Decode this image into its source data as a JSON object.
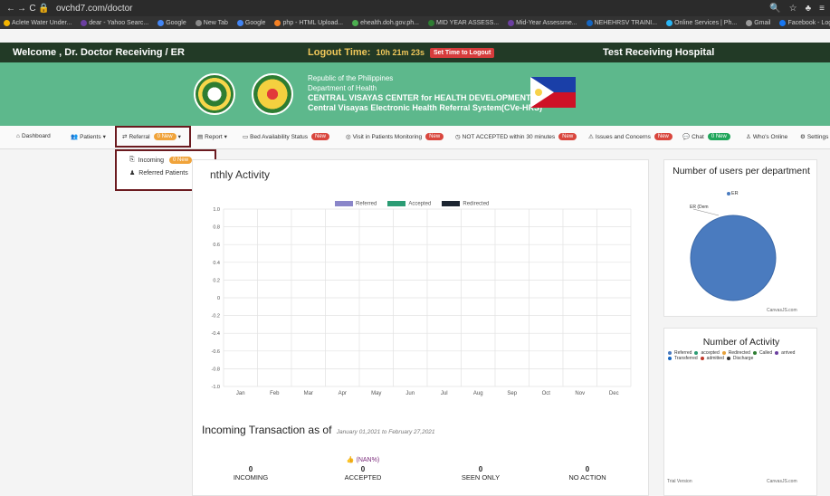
{
  "browser": {
    "url": "ovchd7.com/doctor",
    "bookmarks": [
      "Aclete Water Under...",
      "dear - Yahoo Searc...",
      "Google",
      "New Tab",
      "Google",
      "php - HTML Upload...",
      "ehealth.doh.gov.ph...",
      "MID YEAR ASSESS...",
      "Mid-Year Assessme...",
      "NEHEHRSV TRAINI...",
      "Online Services | Ph...",
      "Gmail",
      "Facebook - Log in o...",
      "Yahoo Gro"
    ]
  },
  "appbar": {
    "welcome": "Welcome , Dr. Doctor Receiving / ER",
    "logout_label": "Logout Time:",
    "logout_time": "10h 21m 23s",
    "logout_btn": "Set Time to Logout",
    "hospital": "Test Receiving Hospital"
  },
  "banner": {
    "line1": "Republic of the Philippines",
    "line2": "Department of Health",
    "line3": "CENTRAL VISAYAS CENTER for HEALTH DEVELOPMENT",
    "line4": "Central Visayas Electronic Health Referral System(CVe-HRS)"
  },
  "nav": {
    "dashboard": "Dashboard",
    "patients": "Patients",
    "referral": "Referral",
    "referral_badge": "0 New",
    "report": "Report",
    "bed_status": "Bed Availability Status",
    "visits": "Visit in Patients Monitoring",
    "not_accepted": "NOT ACCEPTED within 30 minutes",
    "issues": "Issues and Concerns",
    "chat": "Chat",
    "chat_badge": "0 New",
    "whos_online": "Who's Online",
    "settings": "Settings",
    "new_badge": "New"
  },
  "dropdown": {
    "incoming": "Incoming",
    "incoming_badge": "0 New",
    "referred": "Referred Patients"
  },
  "monthly": {
    "title": "nthly Activity"
  },
  "chart_data": {
    "type": "bar",
    "title": "Monthly Activity",
    "categories": [
      "Jan",
      "Feb",
      "Mar",
      "Apr",
      "May",
      "Jun",
      "Jul",
      "Aug",
      "Sep",
      "Oct",
      "Nov",
      "Dec"
    ],
    "series": [
      {
        "name": "Referred",
        "color": "#8a86c9",
        "values": [
          0,
          0,
          0,
          0,
          0,
          0,
          0,
          0,
          0,
          0,
          0,
          0
        ]
      },
      {
        "name": "Accepted",
        "color": "#2b9c74",
        "values": [
          0,
          0,
          0,
          0,
          0,
          0,
          0,
          0,
          0,
          0,
          0,
          0
        ]
      },
      {
        "name": "Redirected",
        "color": "#1b2430",
        "values": [
          0,
          0,
          0,
          0,
          0,
          0,
          0,
          0,
          0,
          0,
          0,
          0
        ]
      }
    ],
    "yticks": [
      "1.0",
      "0.8",
      "0.6",
      "0.4",
      "0.2",
      "0",
      "-0.2",
      "-0.4",
      "-0.6",
      "-0.8",
      "-1.0"
    ],
    "ylim": [
      -1.0,
      1.0
    ],
    "grid": true,
    "legend": "top-center"
  },
  "incoming": {
    "title": "Incoming Transaction as of",
    "daterange": "January 01,2021 to February 27,2021",
    "nan": "(NAN%)",
    "stats": [
      {
        "label": "INCOMING",
        "value": "0"
      },
      {
        "label": "ACCEPTED",
        "value": "0"
      },
      {
        "label": "SEEN ONLY",
        "value": "0"
      },
      {
        "label": "NO ACTION",
        "value": "0"
      }
    ]
  },
  "users": {
    "title": "Number of users per department",
    "legend": "ER",
    "er_label": "ER (Dem",
    "credit": "CanvasJS.com"
  },
  "activity": {
    "title": "Number of Activity",
    "legend": [
      "Referred",
      "accepted",
      "Redirected",
      "Called",
      "arrived",
      "Transferred",
      "admitted",
      "Discharge"
    ],
    "trial": "Trial Version",
    "credit": "CanvasJS.com"
  },
  "colors": {
    "appbar": "#223a26",
    "banner": "#5db88c",
    "highlight": "#6b1a1f",
    "pie": "#4a7bbf"
  }
}
